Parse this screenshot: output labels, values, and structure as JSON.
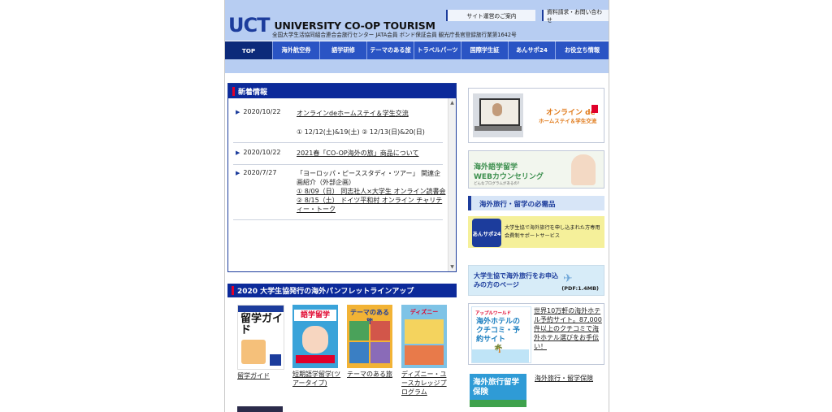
{
  "header": {
    "logo_mark": "UCT",
    "logo_text": "UNIVERSITY CO-OP TOURISM",
    "subtitle": "全国大学生活協同組合連合会旅行センター JATA会員 ボンド保証会員 観光庁長官登録旅行業第1642号",
    "links": [
      "サイト運営のご案内",
      "資料請求・お問い合わせ"
    ]
  },
  "nav": [
    "TOP",
    "海外航空券",
    "語学研修",
    "テーマのある旅",
    "トラベルパーツ",
    "国際学生証",
    "あんサポ24",
    "お役立ち情報"
  ],
  "news": {
    "title": "新着情報",
    "items": [
      {
        "date": "2020/10/22",
        "lines": [
          "オンラインdeホームステイ＆学生交流"
        ],
        "extra": "① 12/12(土)&19(土) ② 12/13(日)&20(日)"
      },
      {
        "date": "2020/10/22",
        "lines": [
          "2021春「CO-OP海外の旅」商品について"
        ]
      },
      {
        "date": "2020/7/27",
        "plain": "「ヨーロッパ・ピーススタディ・ツアー」 関連企画紹介（外部企画）",
        "lines": [
          "① 8/09（日） 同志社人×大学生 オンライン読書会",
          "② 8/15（土） ドイツ平和村 オンライン チャリティー・トーク"
        ]
      }
    ]
  },
  "pamphlets": {
    "title": "2020 大学生協発行の海外パンフレットラインアップ",
    "items": [
      {
        "label": "留学ガイド",
        "cover_title": "留学ガイド"
      },
      {
        "label": "短期語学留学(ツアータイプ)",
        "cover_title": "語学留学"
      },
      {
        "label": "テーマのある旅",
        "cover_title": "テーマのある旅"
      },
      {
        "label": "ディズニー・ユースカレッジプログラム",
        "cover_title": "ディズニー"
      }
    ]
  },
  "right": {
    "online_banner": {
      "title": "オンライン de",
      "sub": "ホームステイ＆学生交流"
    },
    "counseling": {
      "title": "海外語学留学",
      "sub": "WEBカウンセリング",
      "note": "どんなプログラムがあるの？"
    },
    "essentials": {
      "title": "海外旅行・留学の必需品",
      "text": "大学生協で海外旅行を申し込まれた方専用会費制サポートサービス",
      "badge": "あんサポ24"
    },
    "apply_banner": {
      "text": "大学生協で海外旅行をお申込みの方のページ",
      "pdf": "(PDF:1.4MB)"
    },
    "hotel": {
      "brand": "アップルワールド",
      "title": "海外ホテルのクチコミ・予約サイト",
      "link": "世界10万軒の海外ホテル予約サイト。87,000件以上のクチコミで海外ホテル選びをお手伝い！"
    },
    "insurance": {
      "title": "海外旅行留学保険",
      "link": "海外旅行・留学保険"
    }
  },
  "colors": {
    "brand": "#1c3c9c",
    "nav": "#2a54c4",
    "accent": "#e0002a",
    "header_bg": "#b7cdf2"
  }
}
